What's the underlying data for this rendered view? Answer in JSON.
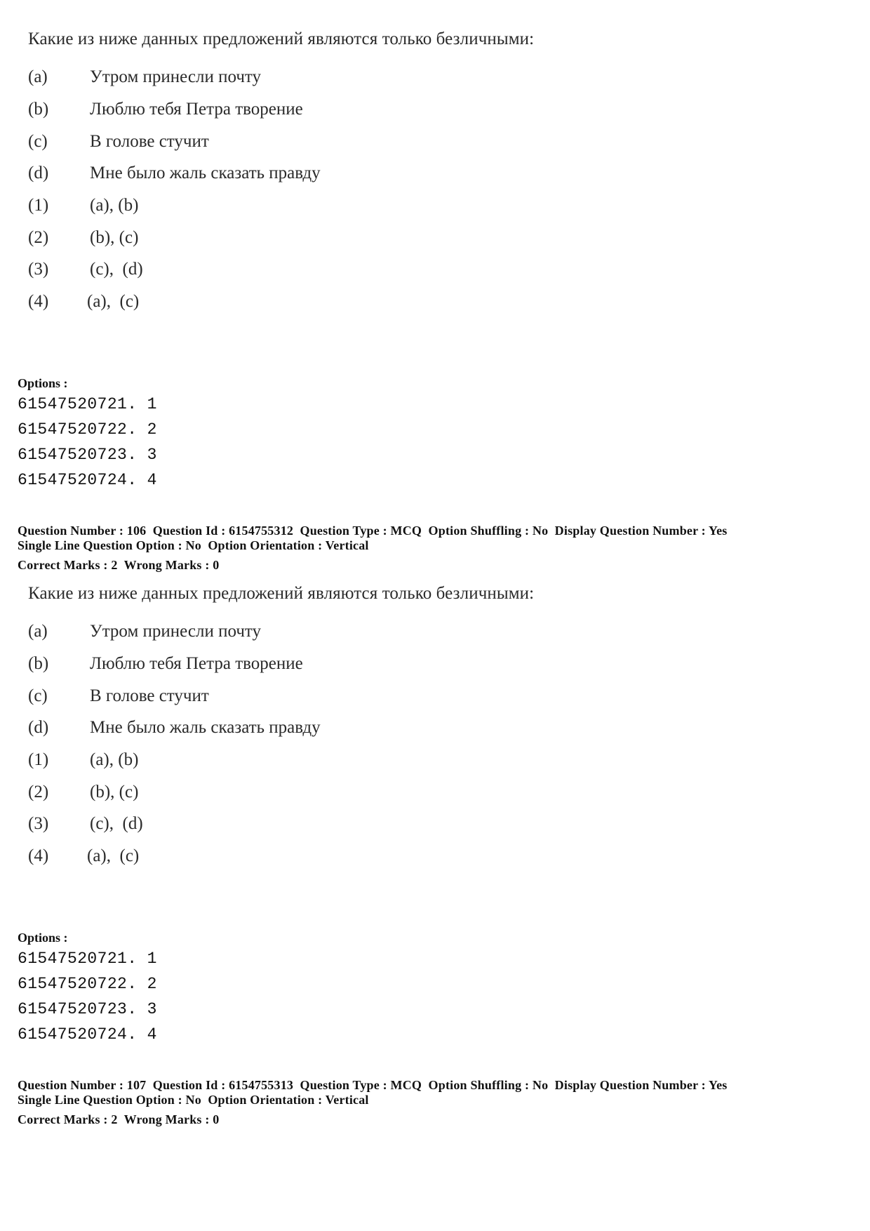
{
  "blocks": [
    {
      "question": {
        "stem": "Какие из ниже данных предложений являются только безличными:",
        "statements": [
          {
            "label": "(a)",
            "text": "Утром принесли почту"
          },
          {
            "label": "(b)",
            "text": "Люблю тебя Петра творение"
          },
          {
            "label": "(c)",
            "text": "В голове стучит"
          },
          {
            "label": "(d)",
            "text": "Мне было жаль сказать правду"
          }
        ],
        "answers": [
          {
            "label": "(1)",
            "text": "(a), (b)"
          },
          {
            "label": "(2)",
            "text": "(b), (c)"
          },
          {
            "label": "(3)",
            "text": "(c),  (d)"
          },
          {
            "label": "(4)",
            "text": "(a),  (c)"
          }
        ]
      },
      "options_heading": "Options :",
      "options": [
        "61547520721. 1",
        "61547520722. 2",
        "61547520723. 3",
        "61547520724. 4"
      ]
    },
    {
      "meta": {
        "line1": "Question Number : 106  Question Id : 6154755312  Question Type : MCQ  Option Shuffling : No  Display Question Number : Yes",
        "line2": "Single Line Question Option : No  Option Orientation : Vertical",
        "line3": "Correct Marks : 2  Wrong Marks : 0"
      },
      "question": {
        "stem": "Какие из ниже данных предложений являются только безличными:",
        "statements": [
          {
            "label": "(a)",
            "text": "Утром принесли почту"
          },
          {
            "label": "(b)",
            "text": "Люблю тебя Петра творение"
          },
          {
            "label": "(c)",
            "text": "В голове стучит"
          },
          {
            "label": "(d)",
            "text": "Мне было жаль сказать правду"
          }
        ],
        "answers": [
          {
            "label": "(1)",
            "text": "(a), (b)"
          },
          {
            "label": "(2)",
            "text": "(b), (c)"
          },
          {
            "label": "(3)",
            "text": "(c),  (d)"
          },
          {
            "label": "(4)",
            "text": "(a),  (c)"
          }
        ]
      },
      "options_heading": "Options :",
      "options": [
        "61547520721. 1",
        "61547520722. 2",
        "61547520723. 3",
        "61547520724. 4"
      ]
    },
    {
      "meta": {
        "line1": "Question Number : 107  Question Id : 6154755313  Question Type : MCQ  Option Shuffling : No  Display Question Number : Yes",
        "line2": "Single Line Question Option : No  Option Orientation : Vertical",
        "line3": "Correct Marks : 2  Wrong Marks : 0"
      }
    }
  ]
}
